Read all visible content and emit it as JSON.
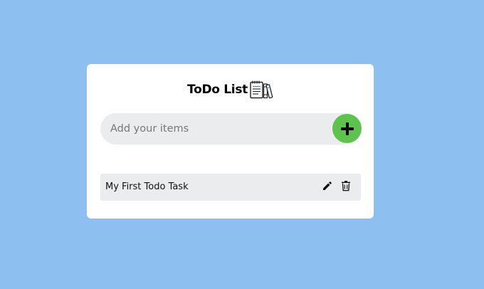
{
  "app": {
    "title": "ToDo List",
    "title_icon": "notepad-icon"
  },
  "input": {
    "placeholder": "Add your items",
    "value": ""
  },
  "add_button": {
    "icon": "plus-icon"
  },
  "todos": [
    {
      "text": "My First Todo Task",
      "edit_icon": "pencil-icon",
      "delete_icon": "trash-icon"
    }
  ],
  "colors": {
    "page_background": "#8dc0f0",
    "card_background": "#ffffff",
    "field_background": "#ebeced",
    "add_button": "#5ec24f"
  }
}
